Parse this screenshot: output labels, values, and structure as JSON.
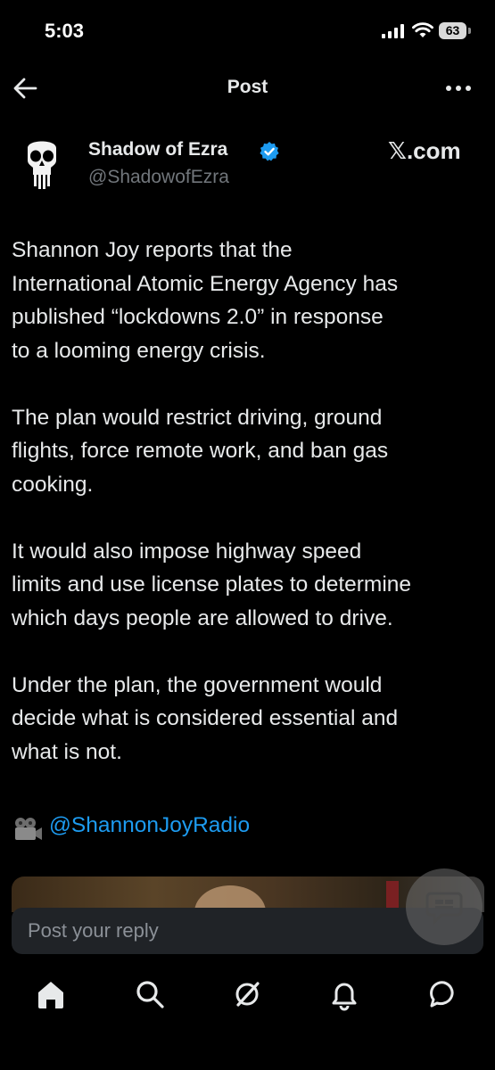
{
  "status_bar": {
    "time": "5:03",
    "battery": "63",
    "icons": [
      "signal-icon",
      "wifi-icon",
      "battery-icon"
    ]
  },
  "nav": {
    "title": "Post",
    "icons": [
      "back-arrow-icon",
      "more-icon"
    ]
  },
  "author": {
    "name": "Shadow of Ezra",
    "handle": "@ShadowofEzra",
    "verified": true,
    "watermark": "𝕏.com"
  },
  "post": {
    "paragraphs": [
      "Shannon Joy reports that the\nInternational Atomic Energy Agency has\npublished “lockdowns 2.0” in response\nto a looming energy crisis.",
      "The plan would restrict driving, ground\nflights, force remote work, and ban gas\ncooking.",
      "It would also impose highway speed\nlimits and use license plates to determine\nwhich days people are allowed to drive.",
      "Under the plan, the government would\ndecide what is considered essential and\nwhat is not."
    ],
    "mention": "@ShannonJoyRadio"
  },
  "reply": {
    "placeholder": "Post your reply"
  },
  "tabs": [
    "home-icon",
    "search-icon",
    "grok-icon",
    "notifications-icon",
    "messages-icon"
  ],
  "colors": {
    "accent": "#1d9bf0",
    "background": "#000000",
    "text": "#e7e9ea",
    "muted": "#71767b"
  }
}
